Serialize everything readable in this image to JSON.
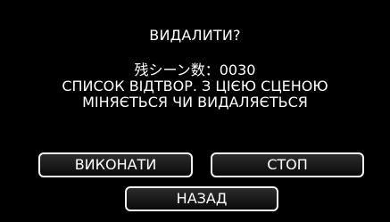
{
  "dialog": {
    "title": "ВИДАЛИТИ?",
    "message_lines": [
      "残シーン数：0030",
      "СПИСОК ВІДТВОР. З ЦІЄЮ СЦЕНОЮ",
      "МІНЯЄТЬСЯ ЧИ ВИДАЛЯЄТЬСЯ"
    ],
    "buttons": {
      "execute_label": "ВИКОНАТИ",
      "stop_label": "СТОП",
      "back_label": "НАЗАД"
    }
  },
  "colors": {
    "background": "#000000",
    "text": "#ffffff",
    "button_border": "#f2f2f2"
  }
}
